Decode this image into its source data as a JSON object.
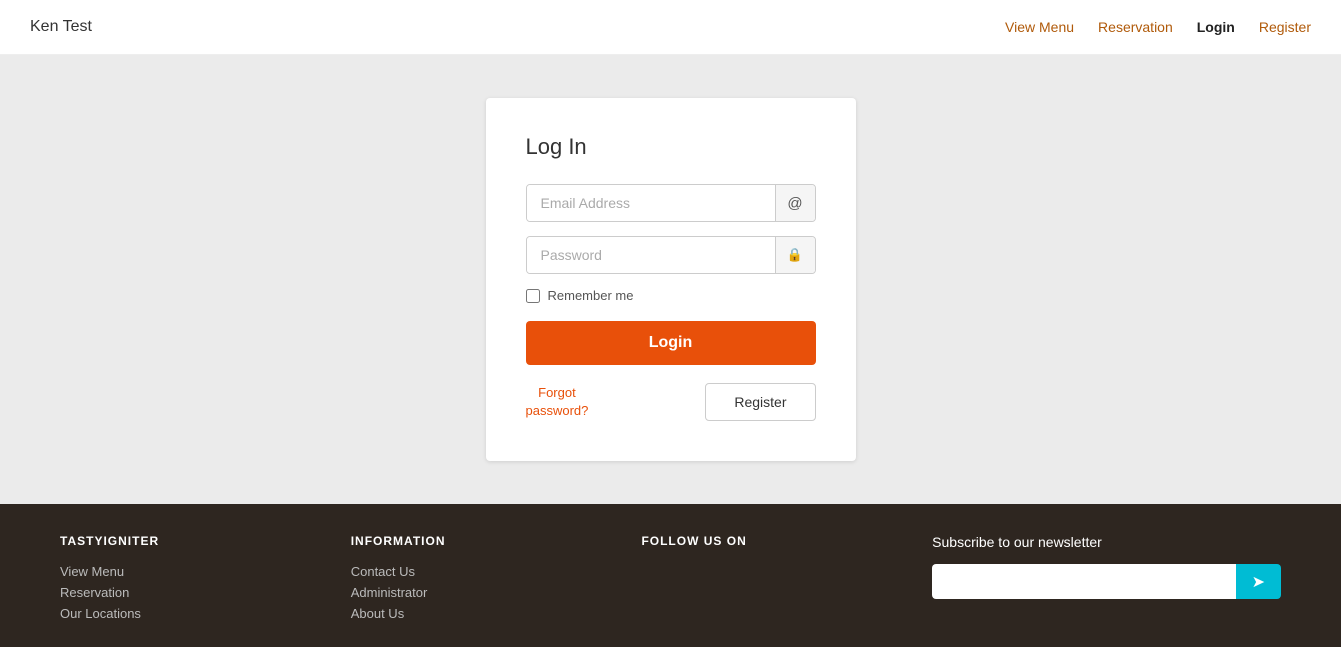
{
  "header": {
    "logo_text": "Ken Test",
    "nav": [
      {
        "label": "View Menu",
        "href": "#",
        "active": false
      },
      {
        "label": "Reservation",
        "href": "#",
        "active": false
      },
      {
        "label": "Login",
        "href": "#",
        "active": true
      },
      {
        "label": "Register",
        "href": "#",
        "active": false
      }
    ]
  },
  "login_card": {
    "title": "Log In",
    "email_placeholder": "Email Address",
    "password_placeholder": "Password",
    "remember_label": "Remember me",
    "login_button": "Login",
    "forgot_link_line1": "Forgot",
    "forgot_link_line2": "password?",
    "register_button": "Register",
    "at_icon": "@",
    "lock_icon": "🔒"
  },
  "footer": {
    "brand_heading": "TASTYIGNITER",
    "brand_links": [
      {
        "label": "View Menu",
        "href": "#"
      },
      {
        "label": "Reservation",
        "href": "#"
      },
      {
        "label": "Our Locations",
        "href": "#"
      }
    ],
    "info_heading": "INFORMATION",
    "info_links": [
      {
        "label": "Contact Us",
        "href": "#"
      },
      {
        "label": "Administrator",
        "href": "#"
      },
      {
        "label": "About Us",
        "href": "#"
      }
    ],
    "social_heading": "FOLLOW US ON",
    "newsletter_title": "Subscribe to our newsletter",
    "newsletter_placeholder": "",
    "newsletter_btn_icon": "➤"
  }
}
